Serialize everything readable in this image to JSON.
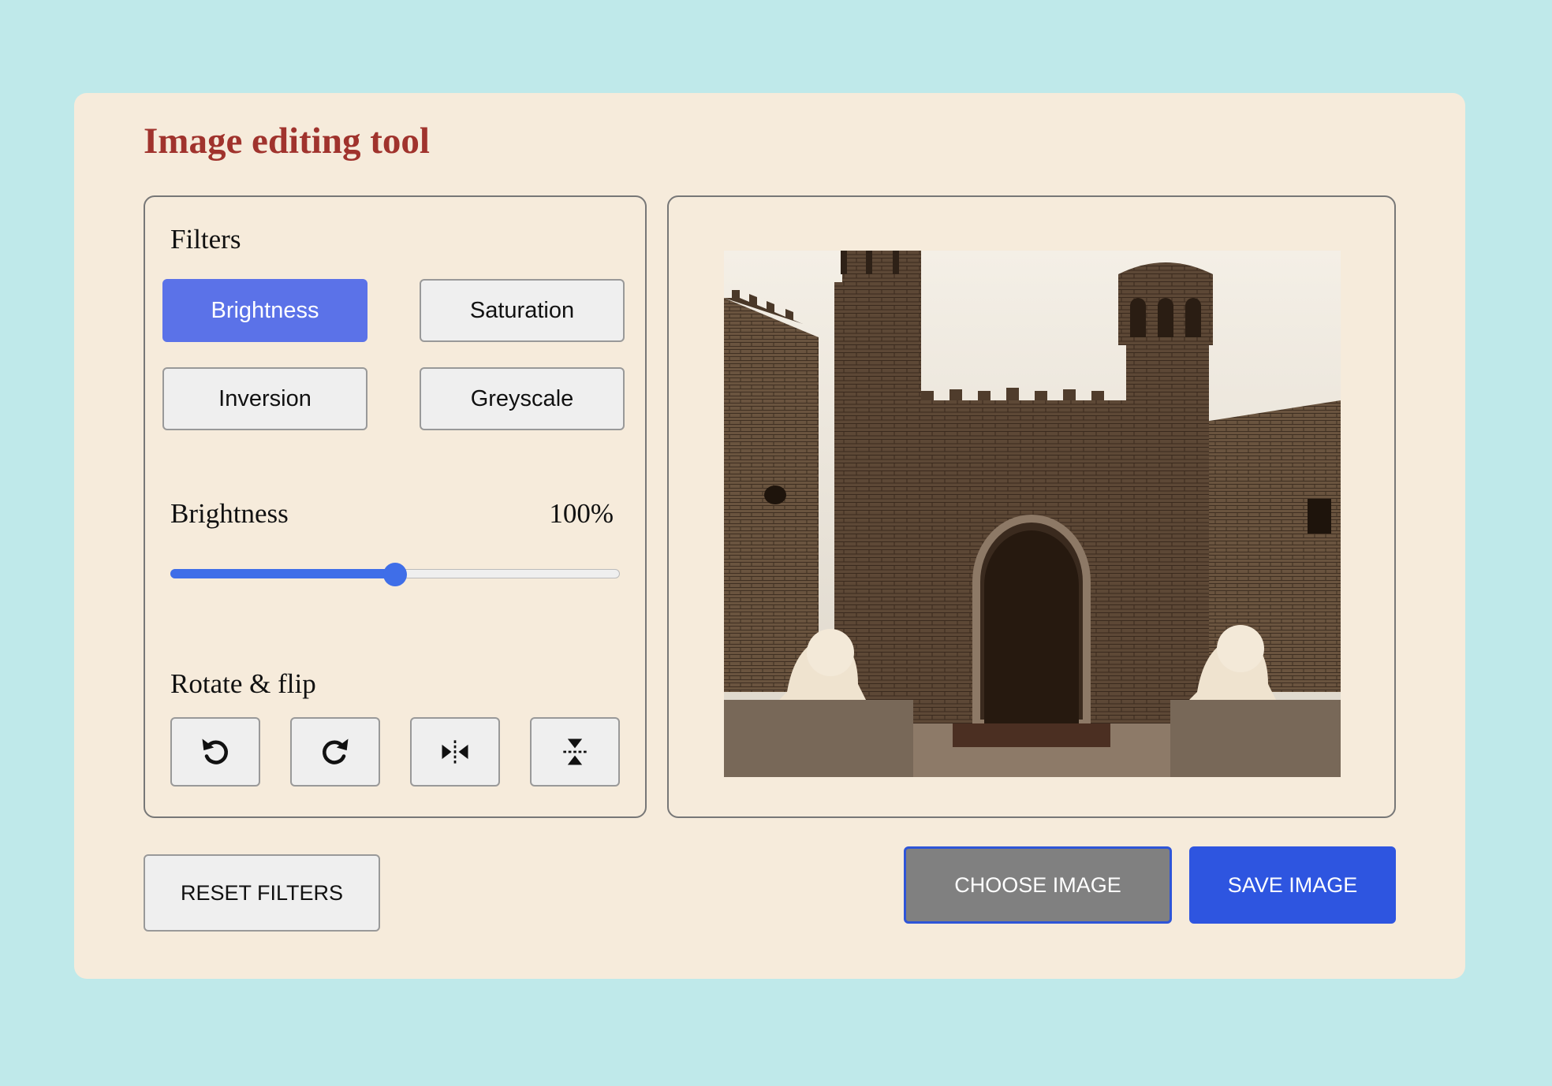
{
  "app": {
    "title": "Image editing tool"
  },
  "filters": {
    "section_label": "Filters",
    "options": [
      {
        "label": "Brightness",
        "active": true
      },
      {
        "label": "Saturation",
        "active": false
      },
      {
        "label": "Inversion",
        "active": false
      },
      {
        "label": "Greyscale",
        "active": false
      }
    ]
  },
  "slider": {
    "name": "Brightness",
    "value_text": "100%",
    "fraction": 0.5
  },
  "rotate": {
    "section_label": "Rotate & flip",
    "buttons": [
      "rotate-left-icon",
      "rotate-right-icon",
      "flip-horizontal-icon",
      "flip-vertical-icon"
    ]
  },
  "actions": {
    "reset_label": "RESET FILTERS",
    "choose_label": "CHOOSE IMAGE",
    "save_label": "SAVE IMAGE"
  },
  "colors": {
    "background": "#bfe9ea",
    "card": "#f6ebdb",
    "title": "#a0332d",
    "active_filter": "#5b72e8",
    "accent": "#2e55e0"
  }
}
